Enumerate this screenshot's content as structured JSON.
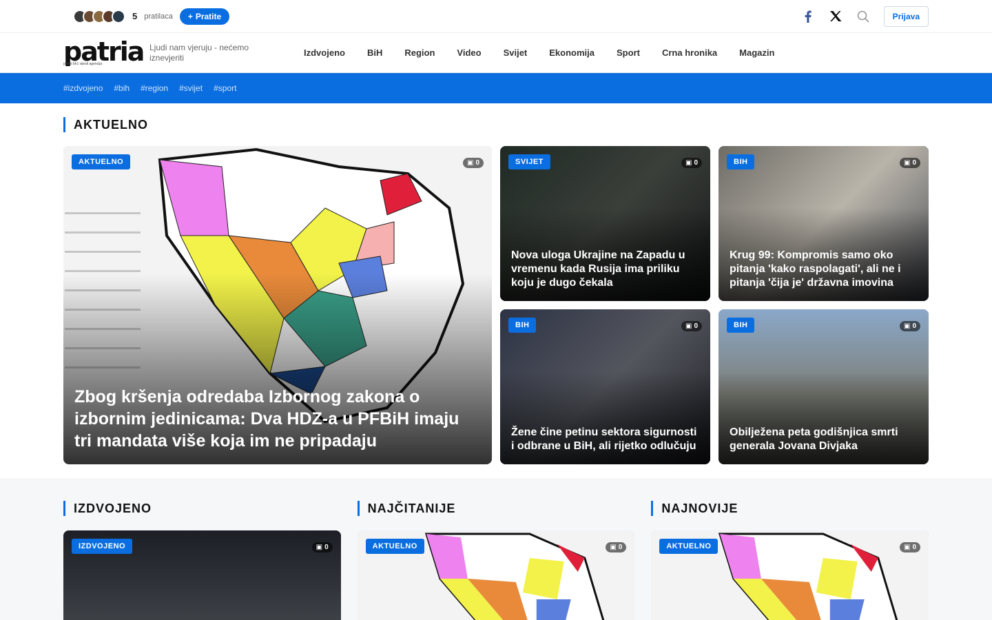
{
  "topbar": {
    "followers_count": "5",
    "followers_label": "pratilaca",
    "follow_label": "Pratite",
    "login_label": "Prijava"
  },
  "header": {
    "logo_text": "patria",
    "logo_tagline": "portal bh1 vijesti agencija",
    "slogan": "Ljudi nam vjeruju - nećemo iznevjeriti",
    "nav": [
      "Izdvojeno",
      "BiH",
      "Region",
      "Video",
      "Svijet",
      "Ekonomija",
      "Sport",
      "Crna hronika",
      "Magazin"
    ]
  },
  "tags": [
    "#izdvojeno",
    "#bih",
    "#region",
    "#svijet",
    "#sport"
  ],
  "aktuelno": {
    "title": "AKTUELNO",
    "main": {
      "badge": "AKTUELNO",
      "comments": "0",
      "title": "Zbog kršenja odredaba Izbornog zakona o izbornim jedinicama: Dva HDZ-a u PFBiH imaju tri mandata više koja im ne pripadaju"
    },
    "cards": [
      {
        "badge": "SVIJET",
        "comments": "0",
        "title": "Nova uloga Ukrajine na Zapadu u vremenu kada Rusija ima priliku koju je dugo čekala"
      },
      {
        "badge": "BIH",
        "comments": "0",
        "title": "Krug 99: Kompromis samo oko pitanja 'kako raspolagati', ali ne i pitanja 'čija je' državna imovina"
      },
      {
        "badge": "BIH",
        "comments": "0",
        "title": "Žene čine petinu sektora sigurnosti i odbrane u BiH, ali rijetko odlučuju"
      },
      {
        "badge": "BIH",
        "comments": "0",
        "title": "Obilježena peta godišnjica smrti generala Jovana Divjaka"
      }
    ]
  },
  "columns": [
    {
      "title": "IZDVOJENO",
      "badge": "IZDVOJENO",
      "comments": "0"
    },
    {
      "title": "NAJČITANIJE",
      "badge": "AKTUELNO",
      "comments": "0"
    },
    {
      "title": "NAJNOVIJE",
      "badge": "AKTUELNO",
      "comments": "0"
    }
  ],
  "colors": {
    "accent": "#0b6ee0"
  },
  "icons": [
    "plus-icon",
    "facebook-icon",
    "x-icon",
    "search-icon",
    "comment-icon"
  ]
}
